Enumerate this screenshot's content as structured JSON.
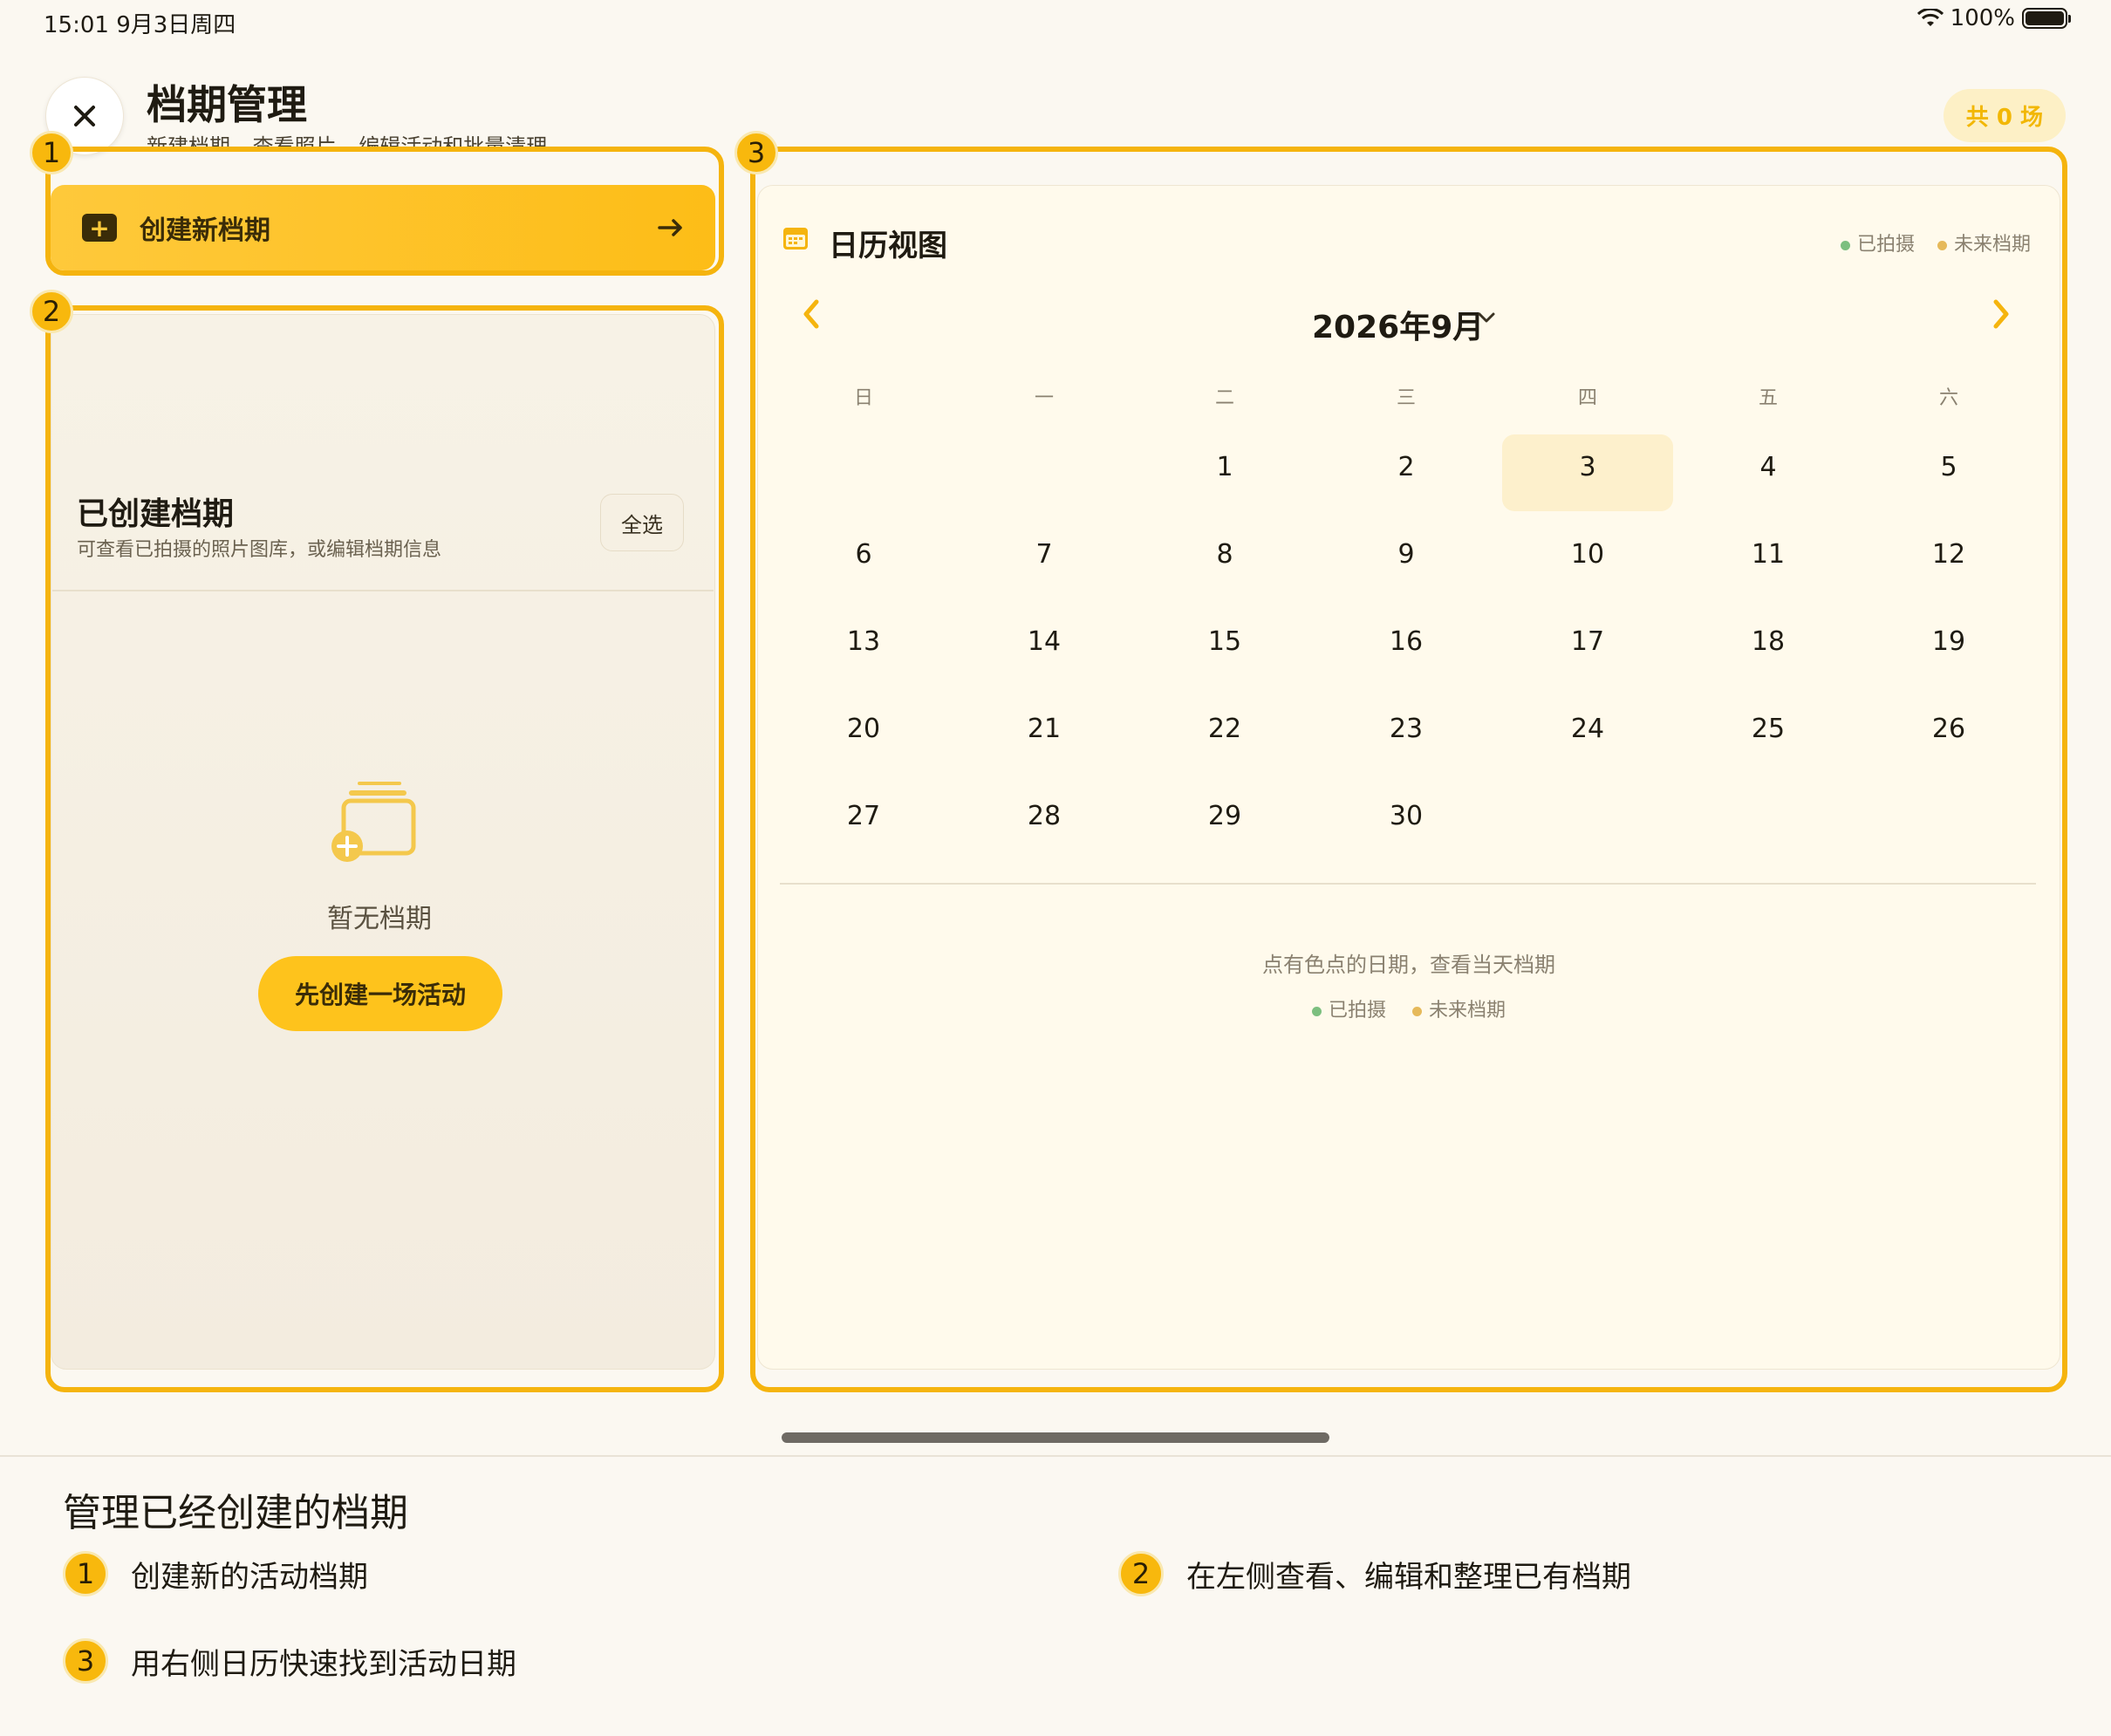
{
  "status_bar": {
    "time_date": "15:01  9月3日周四",
    "battery": "100%"
  },
  "header": {
    "title": "档期管理",
    "subtitle": "新建档期  查看照片  编辑活动和批量清理",
    "count_badge": "共 0 场"
  },
  "markers": {
    "m1": "1",
    "m2": "2",
    "m3": "3"
  },
  "create_button": {
    "label": "创建新档期",
    "icon": "plus-square-icon"
  },
  "left_panel": {
    "title": "已创建档期",
    "subtitle": "可查看已拍摄的照片图库，或编辑档期信息",
    "select_all": "全选",
    "empty_text": "暂无档期",
    "empty_button": "先创建一场活动"
  },
  "calendar": {
    "title": "日历视图",
    "legend": {
      "shot": "已拍摄",
      "future": "未来档期"
    },
    "month": "2026年9月",
    "weekdays": [
      "日",
      "一",
      "二",
      "三",
      "四",
      "五",
      "六"
    ],
    "today": "3",
    "days": [
      "1",
      "2",
      "3",
      "4",
      "5",
      "6",
      "7",
      "8",
      "9",
      "10",
      "11",
      "12",
      "13",
      "14",
      "15",
      "16",
      "17",
      "18",
      "19",
      "20",
      "21",
      "22",
      "23",
      "24",
      "25",
      "26",
      "27",
      "28",
      "29",
      "30"
    ],
    "hint": "点有色点的日期，查看当天档期",
    "colors": {
      "shot": "#7cbf7f",
      "future": "#e6b95a",
      "accent": "#f5b40e"
    }
  },
  "guide": {
    "title": "管理已经创建的档期",
    "items": [
      {
        "num": "1",
        "text": "创建新的活动档期"
      },
      {
        "num": "2",
        "text": "在左侧查看、编辑和整理已有档期"
      },
      {
        "num": "3",
        "text": "用右侧日历快速找到活动日期"
      }
    ]
  }
}
